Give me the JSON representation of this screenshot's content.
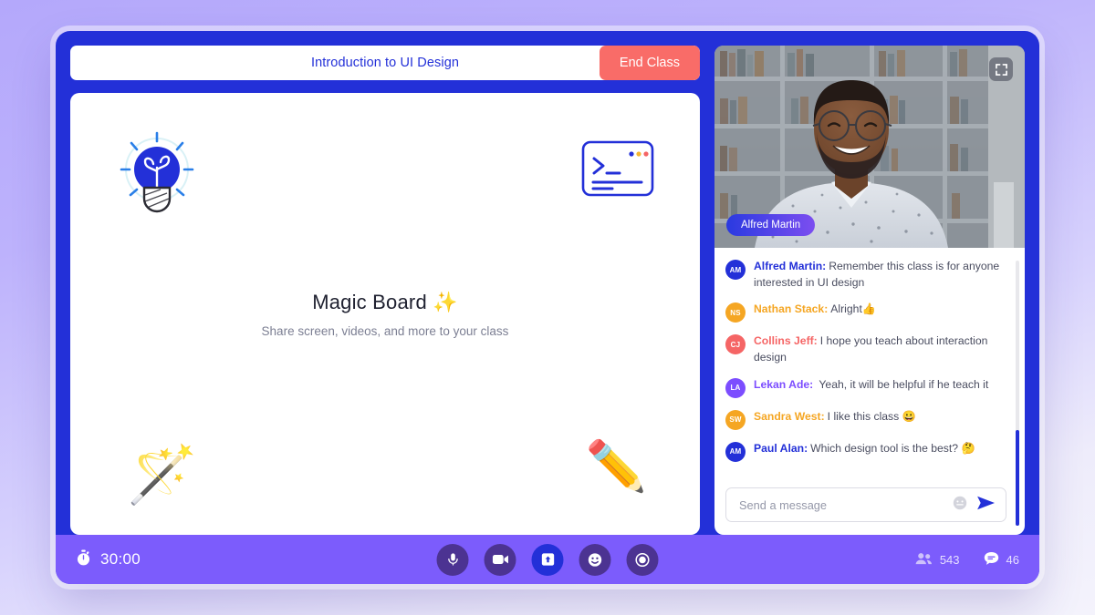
{
  "window": {
    "frame_color": "#2330d8",
    "page_background": "#bdb2fc"
  },
  "topbar": {
    "class_title": "Introduction to UI Design",
    "end_class_label": "End Class",
    "end_class_color": "#f96c68"
  },
  "whiteboard": {
    "title": "Magic Board ✨",
    "subtitle": "Share screen, videos, and more to your class",
    "decorations": [
      {
        "name": "lightbulb-idea-icon",
        "glyph": ""
      },
      {
        "name": "terminal-code-icon",
        "glyph": ""
      },
      {
        "name": "magic-wand-emoji",
        "glyph": "🪄"
      },
      {
        "name": "pencil-emoji",
        "glyph": "✏️"
      }
    ]
  },
  "video": {
    "presenter_name": "Alfred Martin",
    "fullscreen_icon": "fullscreen-icon",
    "badge_gradient_from": "#2a3ae0",
    "badge_gradient_to": "#7c4ef0"
  },
  "chat": {
    "messages": [
      {
        "initials": "AM",
        "name": "Alfred Martin:",
        "text": "Remember this class is for anyone interested in UI design",
        "color": "#2330d8"
      },
      {
        "initials": "NS",
        "name": "Nathan Stack:",
        "text": "Alright👍",
        "color": "#f5a623"
      },
      {
        "initials": "CJ",
        "name": "Collins Jeff:",
        "text": "I hope you teach about interaction design",
        "color": "#f56565"
      },
      {
        "initials": "LA",
        "name": "Lekan Ade:",
        "text": " Yeah, it will be helpful if he teach it",
        "color": "#7c4dff"
      },
      {
        "initials": "SW",
        "name": "Sandra West:",
        "text": "I like this class 😀",
        "color": "#f5a623"
      },
      {
        "initials": "AM",
        "name": "Paul Alan:",
        "text": "Which design tool is the best? 🤔",
        "color": "#2330d8"
      }
    ],
    "input_placeholder": "Send a message",
    "input_value": "",
    "emoji_icon": "emoji-icon",
    "send_icon": "send-icon",
    "scrollbar_color": "#2330d8"
  },
  "bottom_bar": {
    "timer": "30:00",
    "timer_icon": "stopwatch-icon",
    "background": "#7c5cfc",
    "controls": [
      {
        "name": "microphone-button",
        "icon": "microphone-icon",
        "active": false
      },
      {
        "name": "camera-button",
        "icon": "video-camera-icon",
        "active": false
      },
      {
        "name": "share-screen-button",
        "icon": "share-screen-icon",
        "active": true
      },
      {
        "name": "reaction-button",
        "icon": "smiley-icon",
        "active": false
      },
      {
        "name": "record-button",
        "icon": "record-icon",
        "active": false
      }
    ],
    "participants_count": "543",
    "participants_icon": "people-icon",
    "chat_count": "46",
    "chat_icon": "chat-bubble-icon"
  }
}
